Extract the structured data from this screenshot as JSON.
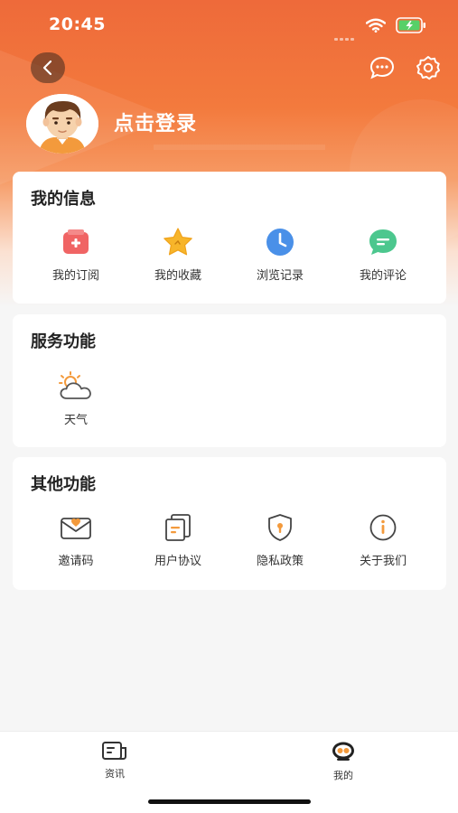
{
  "status_bar": {
    "time": "20:45"
  },
  "header": {
    "login_label": "点击登录"
  },
  "my_info": {
    "title": "我的信息",
    "items": [
      {
        "label": "我的订阅",
        "icon": "subscription-icon"
      },
      {
        "label": "我的收藏",
        "icon": "star-icon"
      },
      {
        "label": "浏览记录",
        "icon": "clock-icon"
      },
      {
        "label": "我的评论",
        "icon": "comment-icon"
      }
    ]
  },
  "services": {
    "title": "服务功能",
    "items": [
      {
        "label": "天气",
        "icon": "weather-icon"
      }
    ]
  },
  "other": {
    "title": "其他功能",
    "items": [
      {
        "label": "邀请码",
        "icon": "envelope-icon"
      },
      {
        "label": "用户协议",
        "icon": "document-icon"
      },
      {
        "label": "隐私政策",
        "icon": "shield-icon"
      },
      {
        "label": "关于我们",
        "icon": "info-icon"
      }
    ]
  },
  "tab_bar": {
    "items": [
      {
        "label": "资讯",
        "icon": "news-icon"
      },
      {
        "label": "我的",
        "icon": "profile-icon"
      }
    ]
  },
  "colors": {
    "accent": "#ee6a3a",
    "text": "#222222",
    "page_bg": "#f6f6f6"
  }
}
